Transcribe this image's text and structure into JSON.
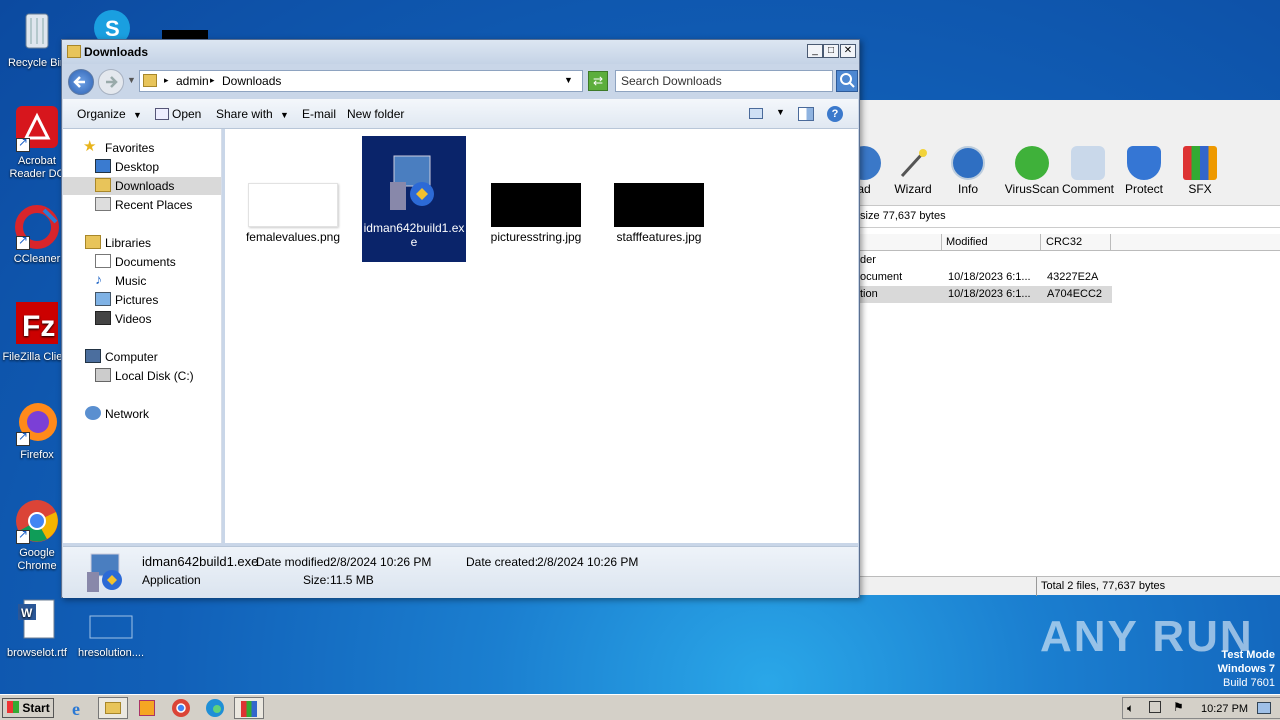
{
  "desktop": {
    "icons": [
      {
        "label": "Recycle Bin"
      },
      {
        "label": "Acrobat Reader DC"
      },
      {
        "label": "CCleaner"
      },
      {
        "label": "FileZilla Client"
      },
      {
        "label": "Firefox"
      },
      {
        "label": "Google Chrome"
      },
      {
        "label": "browselot.rtf"
      },
      {
        "label": "hresolution...."
      }
    ]
  },
  "rar": {
    "toolbar": [
      "ad",
      "Wizard",
      "Info",
      "VirusScan",
      "Comment",
      "Protect",
      "SFX"
    ],
    "path_text": "size 77,637 bytes",
    "columns": [
      "Modified",
      "CRC32"
    ],
    "rows": [
      {
        "name": "der",
        "modified": "",
        "crc": ""
      },
      {
        "name": "ocument",
        "modified": "10/18/2023 6:1...",
        "crc": "43227E2A"
      },
      {
        "name": "tion",
        "modified": "10/18/2023 6:1...",
        "crc": "A704ECC2"
      }
    ],
    "status": "Total 2 files, 77,637 bytes"
  },
  "explorer": {
    "title": "Downloads",
    "breadcrumb": [
      "admin",
      "Downloads"
    ],
    "search_placeholder": "Search Downloads",
    "commands": {
      "organize": "Organize",
      "open": "Open",
      "share": "Share with",
      "email": "E-mail",
      "new_folder": "New folder"
    },
    "nav": {
      "favorites": "Favorites",
      "desktop": "Desktop",
      "downloads": "Downloads",
      "recent": "Recent Places",
      "libraries": "Libraries",
      "documents": "Documents",
      "music": "Music",
      "pictures": "Pictures",
      "videos": "Videos",
      "computer": "Computer",
      "localdisk": "Local Disk (C:)",
      "network": "Network"
    },
    "files": [
      {
        "name": "femalevalues.png"
      },
      {
        "name": "idman642build1.exe",
        "name_line1": "idman642build1.ex",
        "name_line2": "e",
        "selected": true
      },
      {
        "name": "picturesstring.jpg"
      },
      {
        "name": "stafffeatures.jpg"
      }
    ],
    "details": {
      "name": "idman642build1.exe",
      "type": "Application",
      "modified_label": "Date modified:",
      "modified": "2/8/2024 10:26 PM",
      "created_label": "Date created:",
      "created": "2/8/2024 10:26 PM",
      "size_label": "Size:",
      "size": "11.5 MB"
    }
  },
  "taskbar": {
    "start": "Start",
    "clock": "10:27 PM"
  },
  "watermark": {
    "line1": "Test Mode",
    "line2": "Windows 7",
    "line3": "Build 7601",
    "brand": "ANY RUN"
  }
}
